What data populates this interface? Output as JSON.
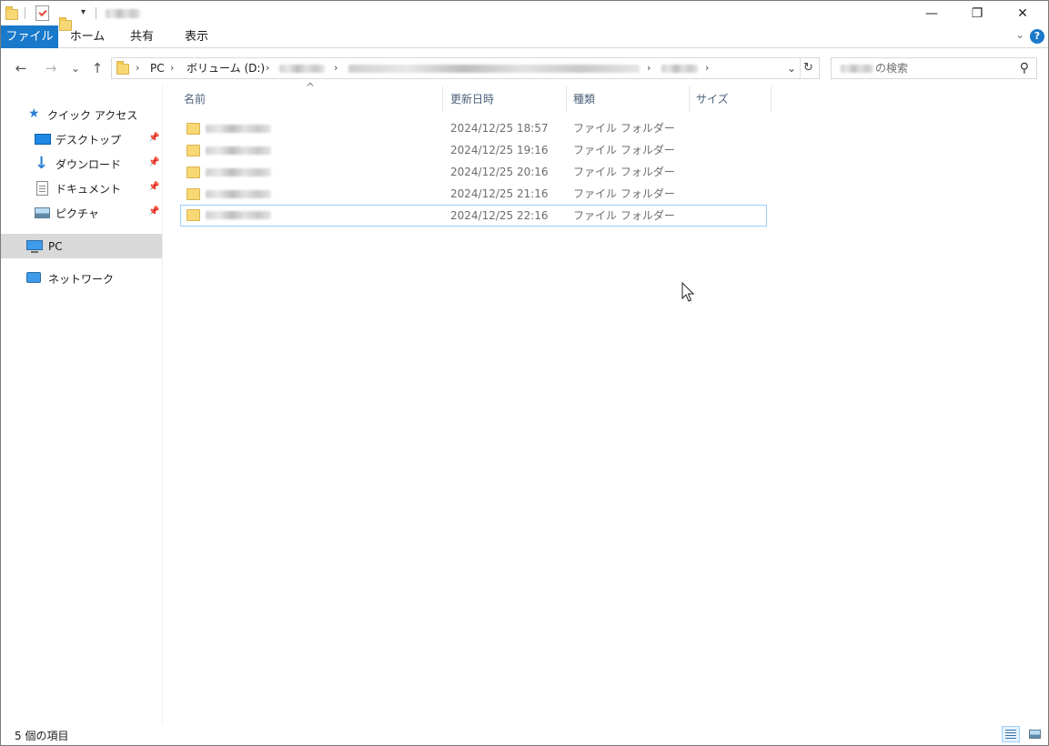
{
  "window": {
    "minimize_glyph": "—",
    "restore_glyph": "❐",
    "close_glyph": "✕"
  },
  "ribbon": {
    "tabs": [
      {
        "label": "ファイル"
      },
      {
        "label": "ホーム"
      },
      {
        "label": "共有"
      },
      {
        "label": "表示"
      }
    ],
    "help_label": "?",
    "collapse_glyph": "⌄"
  },
  "nav": {
    "back_glyph": "←",
    "forward_glyph": "→",
    "recent_glyph": "⌄",
    "up_glyph": "↑"
  },
  "address": {
    "crumbs": [
      "PC",
      "ボリューム (D:)"
    ],
    "chevron": "›",
    "dropdown_glyph": "⌄",
    "refresh_glyph": "↻"
  },
  "search": {
    "placeholder_suffix": "の検索",
    "search_glyph": "⚲"
  },
  "navpane": {
    "quick_access": "クイック アクセス",
    "items": [
      {
        "label": "デスクトップ",
        "icon": "desktop-icon",
        "pinned": true
      },
      {
        "label": "ダウンロード",
        "icon": "download-icon",
        "pinned": true
      },
      {
        "label": "ドキュメント",
        "icon": "document-icon",
        "pinned": true
      },
      {
        "label": "ピクチャ",
        "icon": "pictures-icon",
        "pinned": true
      }
    ],
    "pin_glyph": "📌",
    "pc": "PC",
    "network": "ネットワーク"
  },
  "columns": {
    "sort_glyph": "^",
    "name": "名前",
    "modified": "更新日時",
    "type": "種類",
    "size": "サイズ"
  },
  "files": [
    {
      "modified": "2024/12/25 18:57",
      "type": "ファイル フォルダー"
    },
    {
      "modified": "2024/12/25 19:16",
      "type": "ファイル フォルダー"
    },
    {
      "modified": "2024/12/25 20:16",
      "type": "ファイル フォルダー"
    },
    {
      "modified": "2024/12/25 21:16",
      "type": "ファイル フォルダー"
    },
    {
      "modified": "2024/12/25 22:16",
      "type": "ファイル フォルダー"
    }
  ],
  "status": {
    "item_count": "5 個の項目"
  },
  "colors": {
    "accent": "#1979ca",
    "selection_border": "#99d1ff",
    "nav_selected": "#d9d9d9",
    "folder": "#f8d775"
  }
}
